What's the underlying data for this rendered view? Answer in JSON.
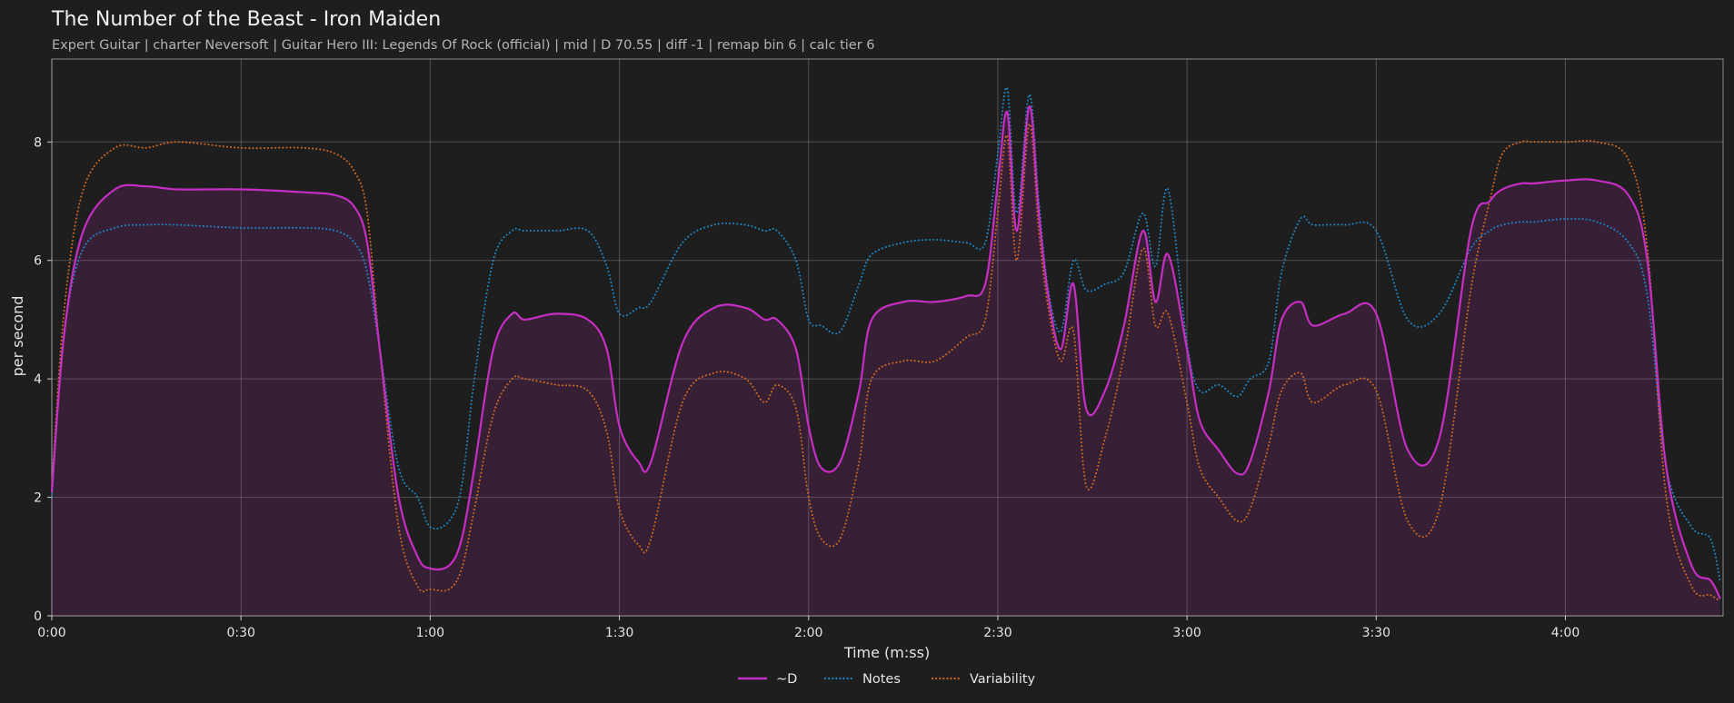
{
  "chart_data": {
    "type": "line",
    "title": "The Number of the Beast - Iron Maiden",
    "subtitle": "Expert Guitar  |  charter Neversoft  |  Guitar Hero III: Legends Of Rock (official)  |  mid  |  D 70.55  |  diff -1  |  remap bin 6  |  calc tier 6",
    "xlabel": "Time (m:ss)",
    "ylabel": "per second",
    "xlim": [
      0,
      265
    ],
    "ylim": [
      0,
      9.4
    ],
    "x_ticks": [
      0,
      30,
      60,
      90,
      120,
      150,
      180,
      210,
      240
    ],
    "x_tick_labels": [
      "0:00",
      "0:30",
      "1:00",
      "1:30",
      "2:00",
      "2:30",
      "3:00",
      "3:30",
      "4:00"
    ],
    "y_ticks": [
      0,
      2,
      4,
      6,
      8
    ],
    "y_tick_labels": [
      "0",
      "2",
      "4",
      "6",
      "8"
    ],
    "grid": true,
    "legend_position": "bottom-center",
    "x": [
      0,
      2,
      5,
      10,
      15,
      20,
      30,
      40,
      45,
      48,
      50,
      52,
      55,
      58,
      60,
      63,
      65,
      67,
      70,
      73,
      75,
      80,
      85,
      88,
      90,
      93,
      95,
      100,
      105,
      110,
      113,
      115,
      118,
      120,
      122,
      125,
      128,
      130,
      135,
      140,
      145,
      148,
      150,
      151.5,
      153,
      155,
      156.5,
      158,
      160,
      162,
      164,
      167,
      170,
      173,
      175,
      177,
      180,
      182,
      185,
      188,
      190,
      193,
      195,
      198,
      200,
      205,
      210,
      215,
      220,
      225,
      228,
      230,
      233,
      235,
      240,
      245,
      250,
      253,
      256,
      260,
      263,
      264.5
    ],
    "series": [
      {
        "name": "~D",
        "color": "#c72ec4",
        "style": "solid",
        "values": [
          2.1,
          4.8,
          6.5,
          7.2,
          7.25,
          7.2,
          7.2,
          7.15,
          7.1,
          6.9,
          6.3,
          4.5,
          2.0,
          1.0,
          0.8,
          0.85,
          1.3,
          2.5,
          4.5,
          5.1,
          5.0,
          5.1,
          5.0,
          4.5,
          3.2,
          2.6,
          2.6,
          4.6,
          5.2,
          5.2,
          5.0,
          5.0,
          4.5,
          3.2,
          2.5,
          2.6,
          3.8,
          5.0,
          5.3,
          5.3,
          5.4,
          5.6,
          7.3,
          8.5,
          6.5,
          8.6,
          6.8,
          5.4,
          4.5,
          5.6,
          3.5,
          3.8,
          4.9,
          6.5,
          5.3,
          6.1,
          4.5,
          3.3,
          2.8,
          2.4,
          2.6,
          3.8,
          5.0,
          5.3,
          4.9,
          5.1,
          5.1,
          2.8,
          3.0,
          6.5,
          7.0,
          7.2,
          7.3,
          7.3,
          7.35,
          7.35,
          7.1,
          6.0,
          2.5,
          0.85,
          0.6,
          0.3
        ]
      },
      {
        "name": "Notes",
        "color": "#1f86c8",
        "style": "dotted",
        "values": [
          2.0,
          4.8,
          6.2,
          6.55,
          6.6,
          6.6,
          6.55,
          6.55,
          6.5,
          6.3,
          5.8,
          4.5,
          2.5,
          2.0,
          1.5,
          1.6,
          2.2,
          4.0,
          6.0,
          6.5,
          6.5,
          6.5,
          6.5,
          5.9,
          5.1,
          5.2,
          5.3,
          6.3,
          6.6,
          6.6,
          6.5,
          6.5,
          6.0,
          5.0,
          4.9,
          4.8,
          5.6,
          6.1,
          6.3,
          6.35,
          6.3,
          6.3,
          7.8,
          8.9,
          6.8,
          8.8,
          7.0,
          5.5,
          4.8,
          6.0,
          5.5,
          5.6,
          5.8,
          6.8,
          5.9,
          7.2,
          4.6,
          3.8,
          3.9,
          3.7,
          4.0,
          4.3,
          5.8,
          6.7,
          6.6,
          6.6,
          6.5,
          5.0,
          5.1,
          6.2,
          6.5,
          6.6,
          6.65,
          6.65,
          6.7,
          6.65,
          6.3,
          5.4,
          2.5,
          1.5,
          1.3,
          0.6
        ]
      },
      {
        "name": "Variability",
        "color": "#d2691e",
        "style": "dotted",
        "values": [
          2.2,
          5.2,
          7.2,
          7.9,
          7.9,
          8.0,
          7.9,
          7.9,
          7.8,
          7.5,
          6.8,
          4.5,
          1.5,
          0.5,
          0.45,
          0.45,
          0.8,
          1.8,
          3.4,
          4.0,
          4.0,
          3.9,
          3.8,
          3.1,
          1.8,
          1.2,
          1.3,
          3.6,
          4.1,
          4.0,
          3.6,
          3.9,
          3.5,
          2.0,
          1.3,
          1.3,
          2.6,
          4.0,
          4.3,
          4.3,
          4.7,
          5.0,
          6.8,
          8.1,
          6.0,
          8.3,
          6.5,
          5.2,
          4.3,
          4.8,
          2.2,
          3.0,
          4.4,
          6.2,
          4.9,
          5.1,
          3.6,
          2.5,
          2.0,
          1.6,
          1.8,
          2.9,
          3.8,
          4.1,
          3.6,
          3.9,
          3.8,
          1.6,
          1.8,
          5.5,
          7.0,
          7.8,
          8.0,
          8.0,
          8.0,
          8.0,
          7.7,
          6.2,
          2.0,
          0.5,
          0.35,
          0.25
        ]
      }
    ]
  }
}
